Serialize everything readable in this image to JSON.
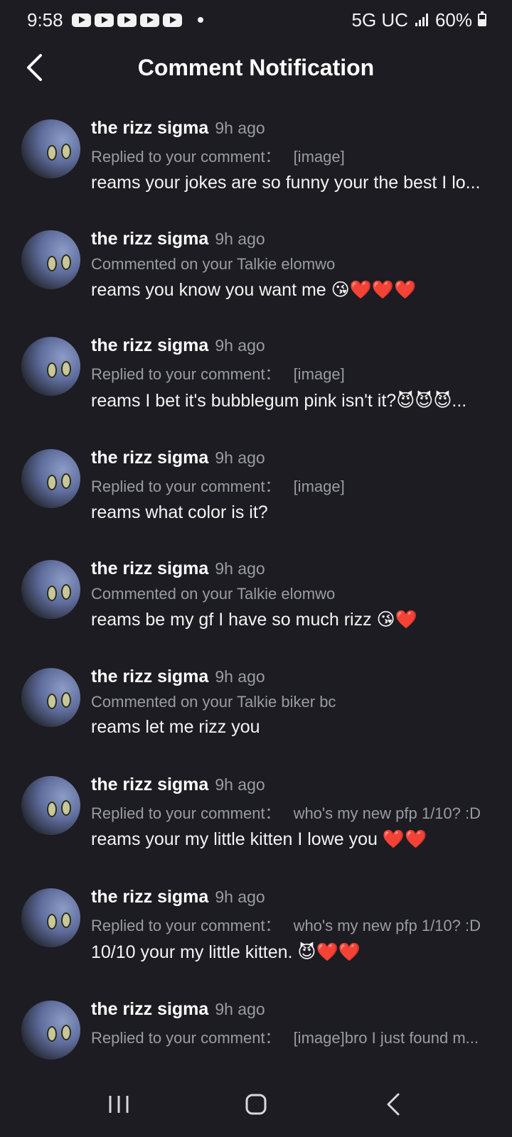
{
  "status_bar": {
    "time": "9:58",
    "network": "5G UC",
    "battery": "60%",
    "battery_level": 0.6,
    "notification_icons": [
      "youtube-icon",
      "youtube-icon",
      "youtube-icon",
      "youtube-icon",
      "youtube-icon"
    ]
  },
  "header": {
    "title": "Comment Notification",
    "back_icon": "chevron-left-icon"
  },
  "notifications": [
    {
      "username": "the rizz sigma",
      "time": "9h ago",
      "action": "Replied to your comment：",
      "target": "[image]",
      "comment": "reams your jokes are so funny your the best I lo..."
    },
    {
      "username": "the rizz sigma",
      "time": "9h ago",
      "action": "Commented on your Talkie elomwo",
      "target": "",
      "comment": "reams you know you want me 😘❤️❤️❤️"
    },
    {
      "username": "the rizz sigma",
      "time": "9h ago",
      "action": "Replied to your comment：",
      "target": "[image]",
      "comment": "reams I bet it's bubblegum pink isn't it?😈😈😈..."
    },
    {
      "username": "the rizz sigma",
      "time": "9h ago",
      "action": "Replied to your comment：",
      "target": "[image]",
      "comment": "reams what color is it?"
    },
    {
      "username": "the rizz sigma",
      "time": "9h ago",
      "action": "Commented on your Talkie elomwo",
      "target": "",
      "comment": "reams be my gf I have so much rizz 😘❤️"
    },
    {
      "username": "the rizz sigma",
      "time": "9h ago",
      "action": "Commented on your Talkie biker bc",
      "target": "",
      "comment": "reams let me rizz you"
    },
    {
      "username": "the rizz sigma",
      "time": "9h ago",
      "action": "Replied to your comment：",
      "target": "who's my new pfp 1/10? :D",
      "comment": "reams your my little kitten I lowe you ❤️❤️"
    },
    {
      "username": "the rizz sigma",
      "time": "9h ago",
      "action": "Replied to your comment：",
      "target": "who's my new pfp 1/10? :D",
      "comment": "10/10 your my little kitten. 😈❤️❤️"
    },
    {
      "username": "the rizz sigma",
      "time": "9h ago",
      "action": "Replied to your comment：",
      "target": "[image]bro I just found m...",
      "comment": ""
    }
  ],
  "nav_bar": {
    "recents_icon": "recent-apps-icon",
    "home_icon": "home-icon",
    "back_icon": "back-icon"
  }
}
